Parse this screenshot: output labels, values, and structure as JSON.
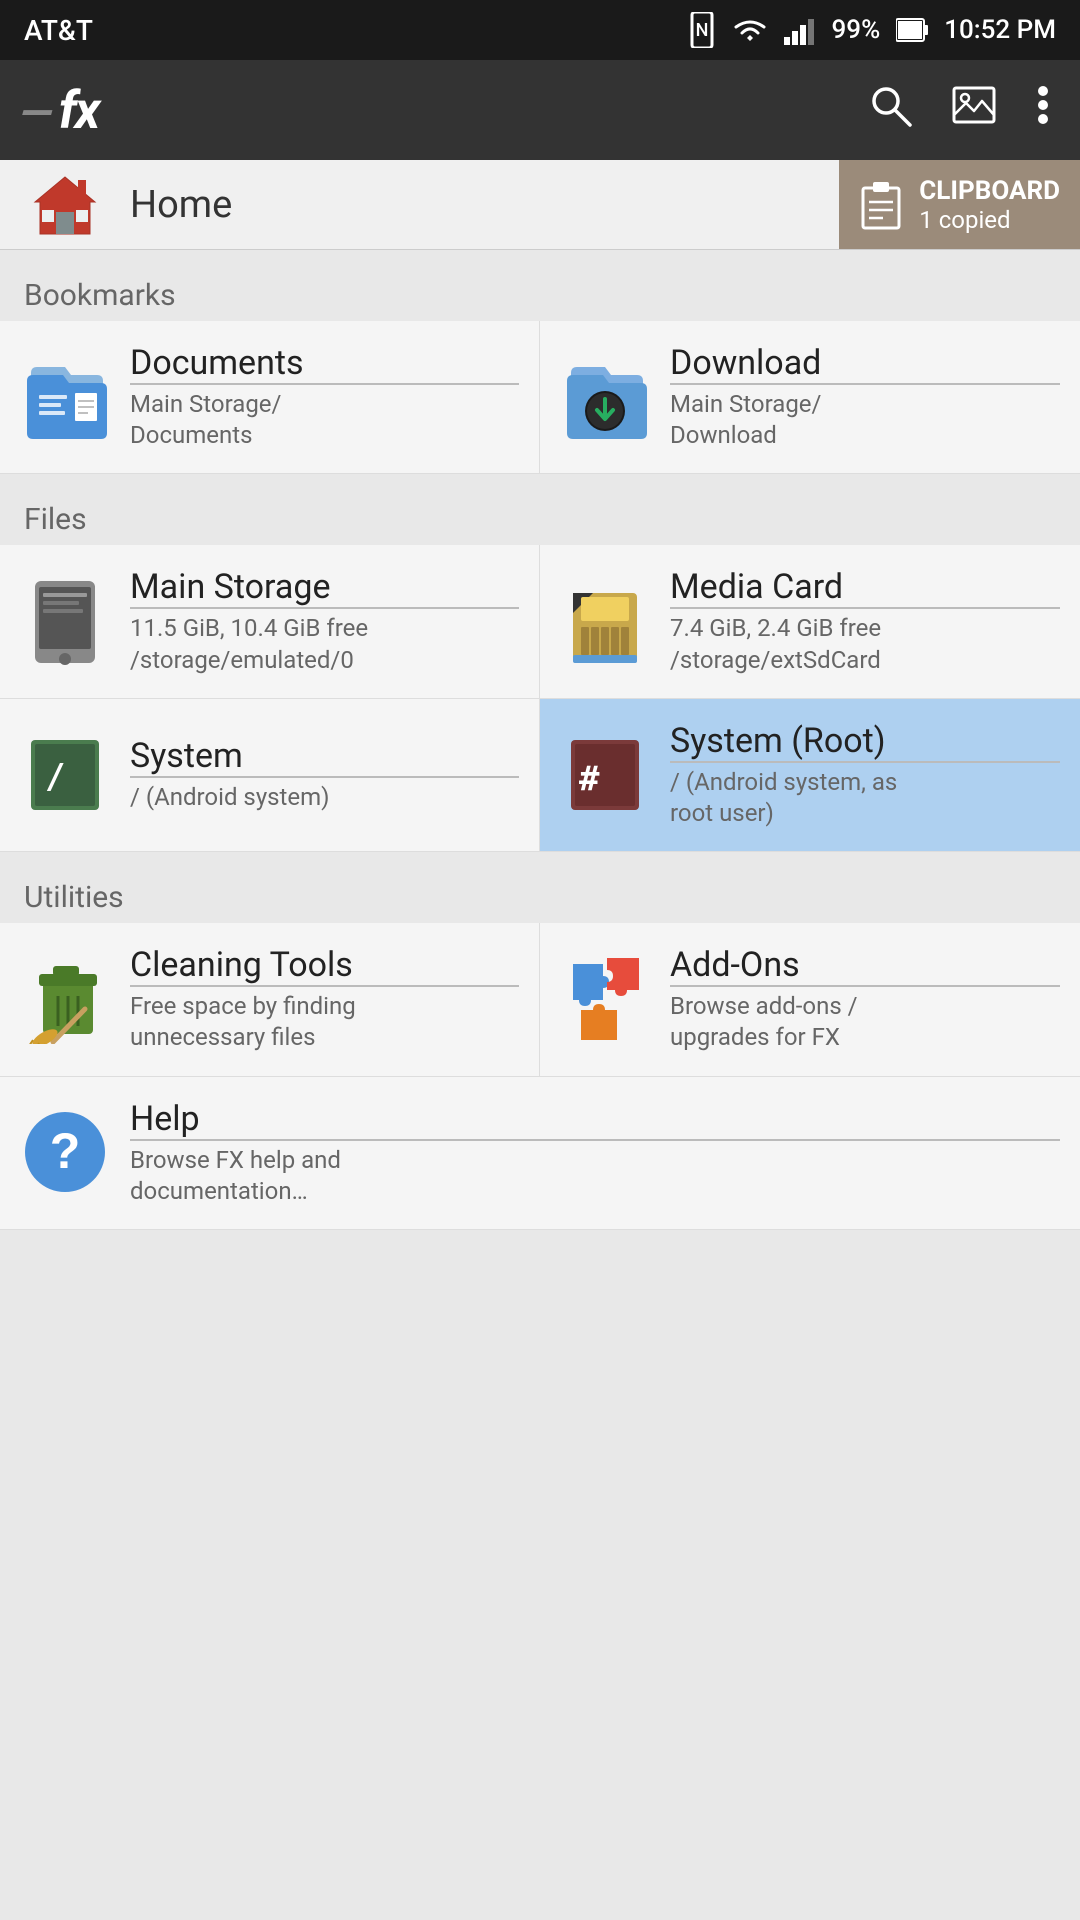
{
  "statusBar": {
    "carrier": "AT&T",
    "battery": "99%",
    "time": "10:52 PM"
  },
  "toolbar": {
    "logo": "fx",
    "logoPrefix": "—",
    "searchIcon": "🔍",
    "imageIcon": "🖼",
    "moreIcon": "⋮"
  },
  "homeBar": {
    "title": "Home",
    "clipboard": {
      "label": "CLIPBOARD",
      "sub": "1 copied"
    }
  },
  "sections": {
    "bookmarks": {
      "label": "Bookmarks",
      "items": [
        {
          "title": "Documents",
          "sub": "Main Storage/\nDocuments"
        },
        {
          "title": "Download",
          "sub": "Main Storage/\nDownload"
        }
      ]
    },
    "files": {
      "label": "Files",
      "items": [
        {
          "title": "Main Storage",
          "sub": "11.5 GiB, 10.4 GiB free\n/storage/emulated/0",
          "highlighted": false
        },
        {
          "title": "Media Card",
          "sub": "7.4 GiB, 2.4 GiB free\n/storage/extSdCard",
          "highlighted": false
        },
        {
          "title": "System",
          "sub": "/ (Android system)",
          "highlighted": false
        },
        {
          "title": "System (Root)",
          "sub": "/ (Android system, as\nroot user)",
          "highlighted": true
        }
      ]
    },
    "utilities": {
      "label": "Utilities",
      "items": [
        {
          "title": "Cleaning Tools",
          "sub": "Free space by finding\nunnecessary files"
        },
        {
          "title": "Add-Ons",
          "sub": "Browse add-ons /\nupgrades for FX"
        },
        {
          "title": "Help",
          "sub": "Browse FX help and\ndocumentation…"
        }
      ]
    }
  }
}
